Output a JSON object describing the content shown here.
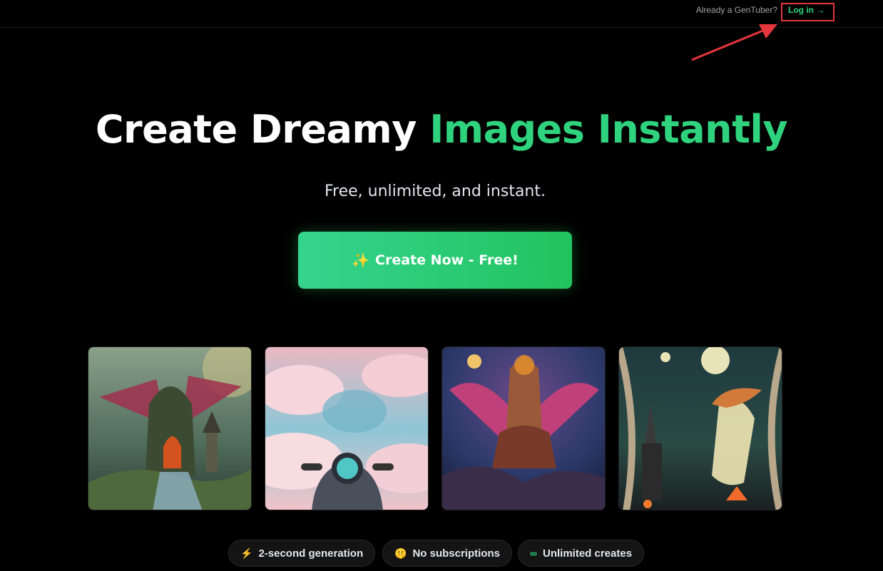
{
  "header": {
    "already_text": "Already a GenTuber?",
    "login_label": "Log in →"
  },
  "hero": {
    "title_white": "Create Dreamy",
    "title_green": "Images Instantly",
    "subtitle": "Free, unlimited, and instant.",
    "cta_label": "Create Now - Free!",
    "cta_icon": "✨"
  },
  "gallery": [
    {
      "name": "dragon-castle-image"
    },
    {
      "name": "pink-clouds-motorcycle-image"
    },
    {
      "name": "fire-demon-dragon-image"
    },
    {
      "name": "moon-goddess-image"
    }
  ],
  "features": [
    {
      "icon": "⚡",
      "label": "2-second generation",
      "icon_name": "lightning-icon"
    },
    {
      "icon": "🤫",
      "label": "No subscriptions",
      "icon_name": "shush-emoji-icon"
    },
    {
      "icon": "∞",
      "label": "Unlimited creates",
      "icon_name": "infinity-icon"
    }
  ],
  "colors": {
    "accent": "#2fd37e",
    "background": "#000000",
    "highlight_box": "#e5363c"
  }
}
